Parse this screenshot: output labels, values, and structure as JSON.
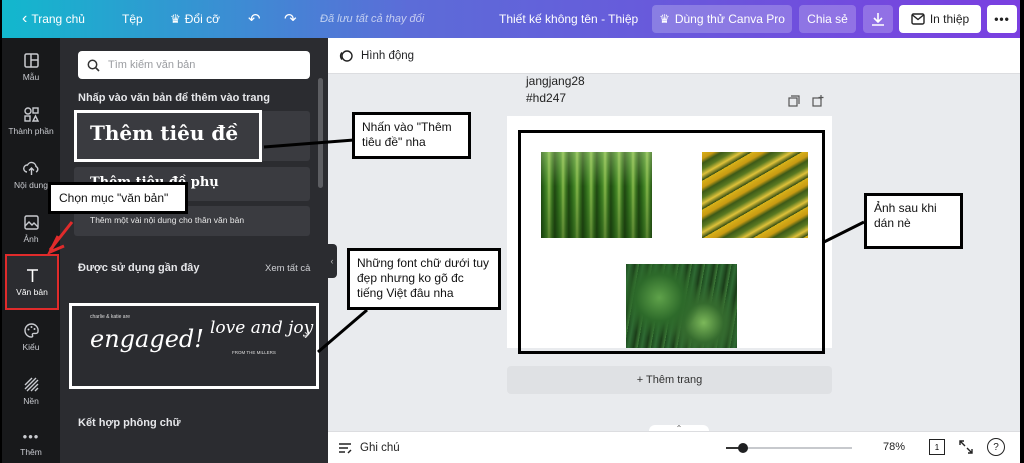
{
  "topbar": {
    "home": "Trang chủ",
    "file": "Tệp",
    "resize": "Đổi cỡ",
    "saved": "Đã lưu tất cả thay đổi",
    "title": "Thiết kế không tên - Thiệp",
    "try_pro": "Dùng thử Canva Pro",
    "share": "Chia sẻ",
    "print": "In thiệp",
    "more": "•••"
  },
  "rail": [
    {
      "label": "Mẫu",
      "icon": "template-icon"
    },
    {
      "label": "Thành phần",
      "icon": "elements-icon"
    },
    {
      "label": "Nội dung",
      "icon": "upload-icon"
    },
    {
      "label": "Ảnh",
      "icon": "photo-icon"
    },
    {
      "label": "Văn bản",
      "icon": "text-icon"
    },
    {
      "label": "Kiểu",
      "icon": "palette-icon"
    },
    {
      "label": "Nền",
      "icon": "background-icon"
    },
    {
      "label": "Thêm",
      "icon": "more-icon"
    }
  ],
  "panel": {
    "search_placeholder": "Tìm kiếm văn bản",
    "click_to_add": "Nhấp vào văn bản để thêm vào trang",
    "heading": "Thêm tiêu đề",
    "subheading": "Thêm tiêu đề phụ",
    "body": "Thêm một vài nội dung cho thân văn bản",
    "recent_title": "Được sử dụng gần đây",
    "see_all": "Xem tất cả",
    "combo_title": "Kết hợp phông chữ",
    "recent_card": {
      "small_top": "charlie & katie are",
      "engaged": "engaged!",
      "love": "love and joy",
      "small_bottom": "FROM THE MILLERS"
    }
  },
  "main": {
    "animate": "Hình động",
    "meta_line1": "jangjang28",
    "meta_line2": "#hd247",
    "add_page": "+ Thêm trang",
    "collapse": "‹"
  },
  "bottombar": {
    "notes": "Ghi chú",
    "zoom_percent": 78,
    "zoom_label": "78%",
    "page_count": "1",
    "help": "?"
  },
  "annotations": {
    "choose_text": "Chọn mục \"văn bản\"",
    "click_heading": "Nhấn vào \"Thêm tiêu đề\" nha",
    "fonts_note": "Những font chữ dưới tuy đẹp nhưng ko gõ đc tiếng Việt đâu nha",
    "image_after": "Ảnh sau khi dán nè"
  },
  "colors": {
    "gradient_start": "#12b8cd",
    "gradient_end": "#7a3fe0",
    "rail_bg": "#18191b",
    "panel_bg": "#2b2c30",
    "highlight_red": "#e02b2b"
  }
}
